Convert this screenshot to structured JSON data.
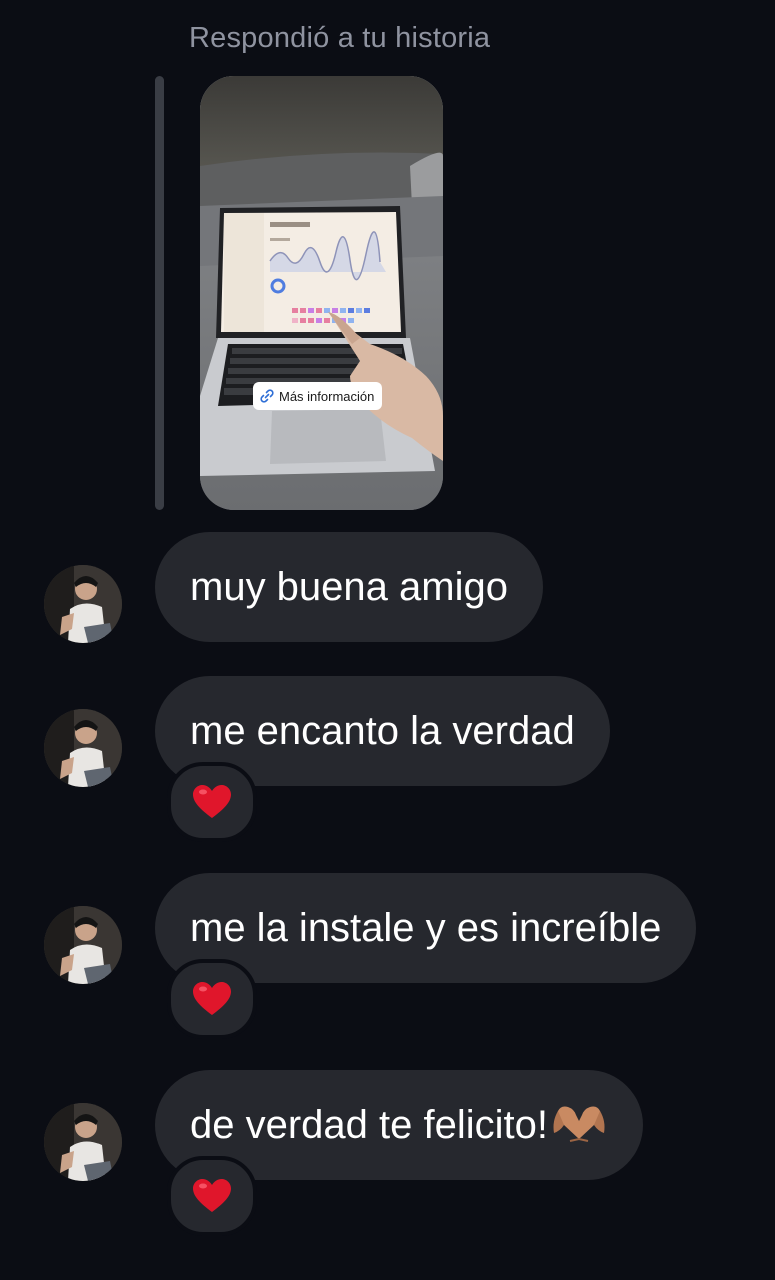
{
  "story": {
    "caption": "Respondió a tu historia",
    "link_label": "Más información",
    "link_icon": "link-icon"
  },
  "messages": [
    {
      "text": "muy buena amigo",
      "reaction": null
    },
    {
      "text": "me encanto la verdad",
      "reaction": "heart-icon"
    },
    {
      "text": "me la instale y es increíble",
      "reaction": "heart-icon"
    },
    {
      "text": "de verdad te felicito!",
      "reaction": "heart-icon",
      "trailing_emoji": "heart-hands-icon"
    }
  ],
  "colors": {
    "background": "#0b0d14",
    "bubble": "#26282e",
    "caption": "#8f93a0",
    "heart": "#e0162b"
  }
}
